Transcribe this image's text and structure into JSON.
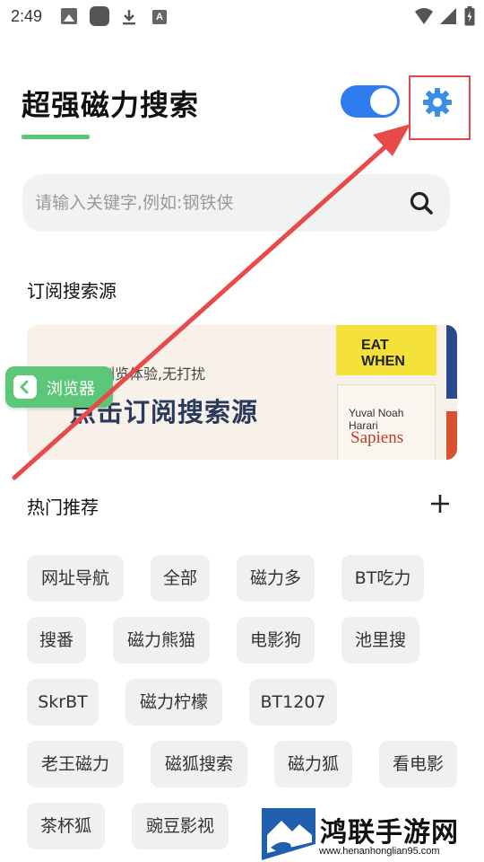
{
  "status_bar": {
    "time": "2:49",
    "icons": [
      "image-icon",
      "app-icon",
      "download-icon",
      "font-icon",
      "wifi-icon",
      "signal-icon",
      "battery-icon"
    ]
  },
  "header": {
    "title": "超强磁力搜索",
    "toggle_on": true,
    "accent_color": "#5cc779",
    "toggle_color": "#2f7cf0",
    "gear_color": "#3b8ee8"
  },
  "search": {
    "placeholder": "请输入关键字,例如:钢铁侠"
  },
  "subscribe": {
    "section_title": "订阅搜索源",
    "banner_small": "超强浏览体验,无打扰",
    "banner_big": "点击订阅搜索源",
    "book1_title": "EAT WHEN",
    "book2_author": "Yuval Noah Harari",
    "book2_title": "Sapiens"
  },
  "browser_badge": {
    "label": "浏览器"
  },
  "hot": {
    "section_title": "热门推荐",
    "add_label": "+",
    "tags": [
      "网址导航",
      "全部",
      "磁力多",
      "BT吃力",
      "搜番",
      "磁力熊猫",
      "电影狗",
      "池里搜",
      "SkrBT",
      "磁力柠檬",
      "BT1207",
      "老王磁力",
      "磁狐搜索",
      "磁力狐",
      "看电影",
      "茶杯狐",
      "豌豆影视"
    ]
  },
  "watermark": {
    "name": "鸿联手游网",
    "url": "www.henanhonglian95.com"
  },
  "annotation": {
    "highlight_color": "#e04a4a"
  }
}
